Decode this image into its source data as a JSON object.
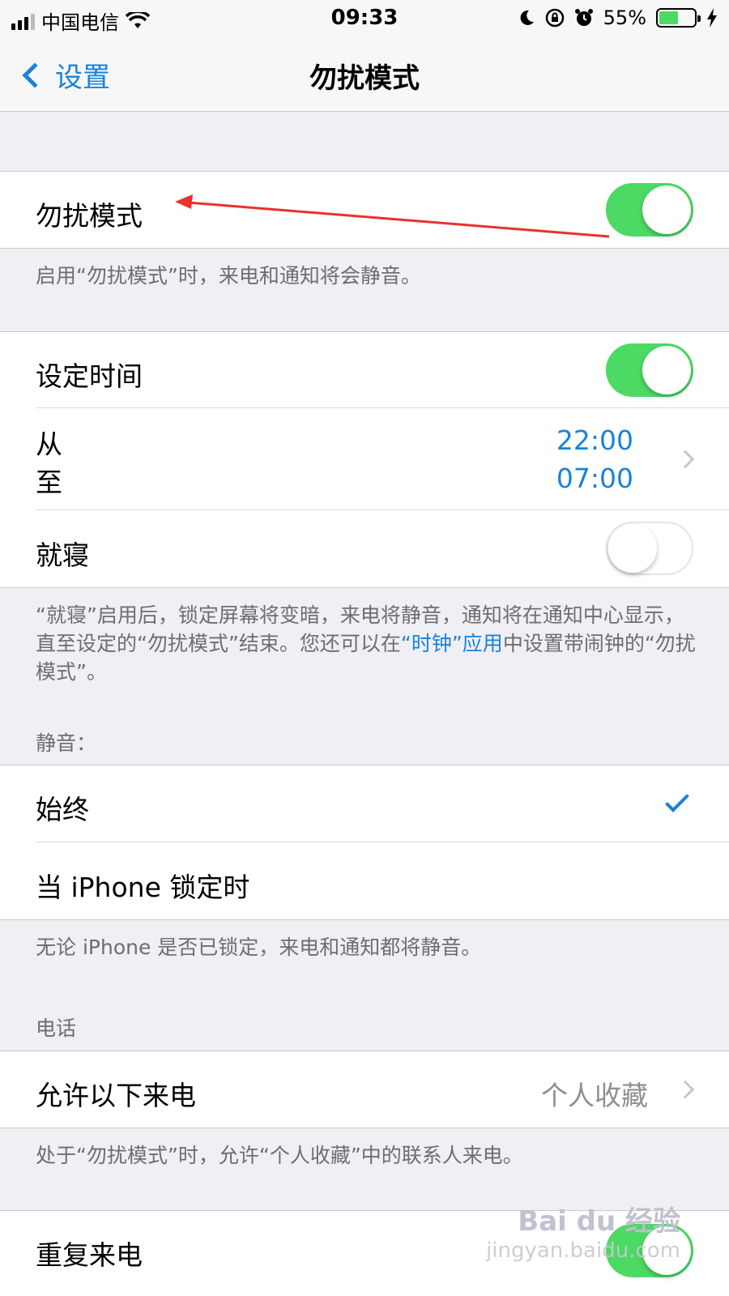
{
  "status_bar": {
    "carrier": "中国电信",
    "time": "09:33",
    "battery_percent": "55%",
    "battery_level": 0.55,
    "icons": [
      "signal-icon",
      "wifi-icon",
      "moon-icon",
      "rotation-lock-icon",
      "alarm-icon",
      "battery-icon",
      "charging-icon"
    ]
  },
  "nav": {
    "back_label": "设置",
    "title": "勿扰模式"
  },
  "dnd": {
    "label": "勿扰模式",
    "on": true,
    "footer": "启用“勿扰模式”时，来电和通知将会静音。"
  },
  "schedule": {
    "label": "设定时间",
    "on": true,
    "from_label": "从",
    "to_label": "至",
    "from_time": "22:00",
    "to_time": "07:00"
  },
  "bedtime": {
    "label": "就寝",
    "on": false,
    "footer_part1": "“就寝”启用后，锁定屏幕将变暗，来电将静音，通知将在通知中心显示，直至设定的“勿扰模式”结束。您还可以在",
    "footer_link": "“时钟”应用",
    "footer_part2": "中设置带闹钟的“勿扰模式”。"
  },
  "silence": {
    "header": "静音：",
    "always_label": "始终",
    "locked_label": "当 iPhone 锁定时",
    "selected": "始终",
    "footer": "无论 iPhone 是否已锁定，来电和通知都将静音。"
  },
  "phone": {
    "header": "电话",
    "allow_calls_label": "允许以下来电",
    "allow_calls_value": "个人收藏",
    "footer": "处于“勿扰模式”时，允许“个人收藏”中的联系人来电。",
    "repeated_calls_label": "重复来电",
    "repeated_on": true
  },
  "watermark": {
    "brand": "Bai du 经验",
    "url": "jingyan.baidu.com"
  },
  "colors": {
    "accent": "#1a82d8",
    "toggle_on": "#4cd964",
    "annotation_arrow": "#e8322b"
  }
}
